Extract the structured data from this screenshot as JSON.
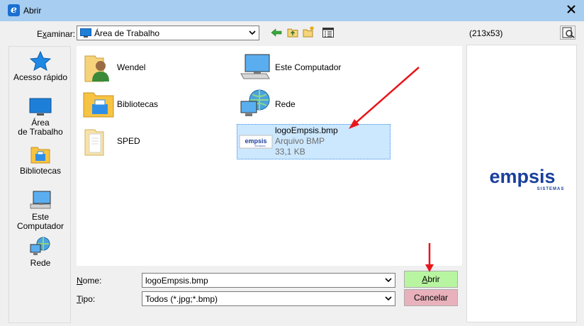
{
  "window": {
    "title": "Abrir",
    "app_icon_letter": "e"
  },
  "toolbar": {
    "look_in_label_pre": "E",
    "look_in_label_accel": "x",
    "look_in_label_post": "aminar:",
    "look_in_value": "Área de Trabalho"
  },
  "places": [
    {
      "label_lines": [
        "Acesso rápido"
      ],
      "icon": "star-icon"
    },
    {
      "label_lines": [
        "Área",
        "de Trabalho"
      ],
      "icon": "desktop-icon"
    },
    {
      "label_lines": [
        "Bibliotecas"
      ],
      "icon": "libraries-icon"
    },
    {
      "label_lines": [
        "Este Computador"
      ],
      "icon": "computer-icon"
    },
    {
      "label_lines": [
        "Rede"
      ],
      "icon": "network-icon"
    }
  ],
  "files": [
    {
      "name": "Wendel",
      "icon": "user-folder-icon"
    },
    {
      "name": "Este Computador",
      "icon": "computer-icon"
    },
    {
      "name": "Bibliotecas",
      "icon": "libraries-folder-icon"
    },
    {
      "name": "Rede",
      "icon": "network-icon"
    },
    {
      "name": "SPED",
      "icon": "folder-icon"
    },
    {
      "name": "logoEmpsis.bmp",
      "type": "Arquivo BMP",
      "size": "33,1 KB",
      "icon": "bmp-thumbnail-icon",
      "selected": true
    }
  ],
  "preview": {
    "dimensions": "(213x53)",
    "logo_word": "empsis",
    "logo_sub": "SISTEMAS"
  },
  "form": {
    "name_label_accel": "N",
    "name_label_post": "ome:",
    "name_value": "logoEmpsis.bmp",
    "type_label_accel": "T",
    "type_label_post": "ipo:",
    "type_value": "Todos (*.jpg;*.bmp)"
  },
  "buttons": {
    "open_accel": "A",
    "open_post": "brir",
    "cancel": "Cancelar"
  },
  "colors": {
    "titlebar": "#a7cdf0",
    "selection": "#cce8ff",
    "open_button": "#b8f5a0",
    "cancel_button": "#e8b1bb",
    "annotation_arrow": "#e8161b"
  }
}
